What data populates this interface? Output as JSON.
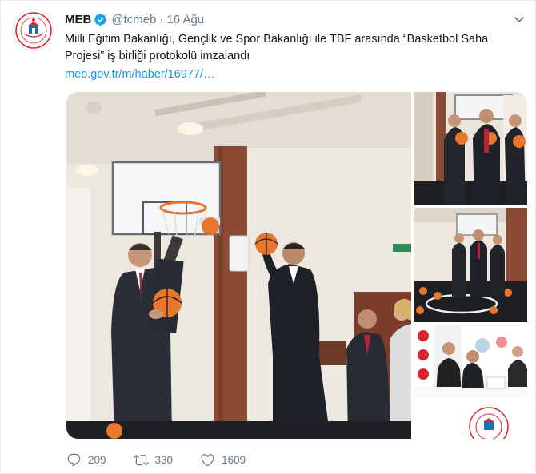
{
  "tweet": {
    "name": "MEB",
    "handle": "@tcmeb",
    "separator": "·",
    "time": "16 Ağu",
    "text": "Milli Eğitim Bakanlığı, Gençlik ve Spor Bakanlığı ile TBF arasında “Basketbol Saha Projesi” iş birliği protokolü imzalandı",
    "link": "meb.gov.tr/m/haber/16977/…",
    "avatar_icon": "meb-logo-icon",
    "verified_icon": "verified-badge-icon",
    "caret_icon": "chevron-down-icon"
  },
  "actions": {
    "reply_count": "209",
    "retweet_count": "330",
    "like_count": "1609",
    "reply_icon": "reply-icon",
    "retweet_icon": "retweet-icon",
    "like_icon": "heart-icon"
  },
  "colors": {
    "text": "#14171a",
    "muted": "#657786",
    "link": "#1b95e0",
    "verified": "#1da1f2",
    "ball": "#e8772e",
    "stage_wall": "#efebe4",
    "banner_red": "#d9262c"
  }
}
